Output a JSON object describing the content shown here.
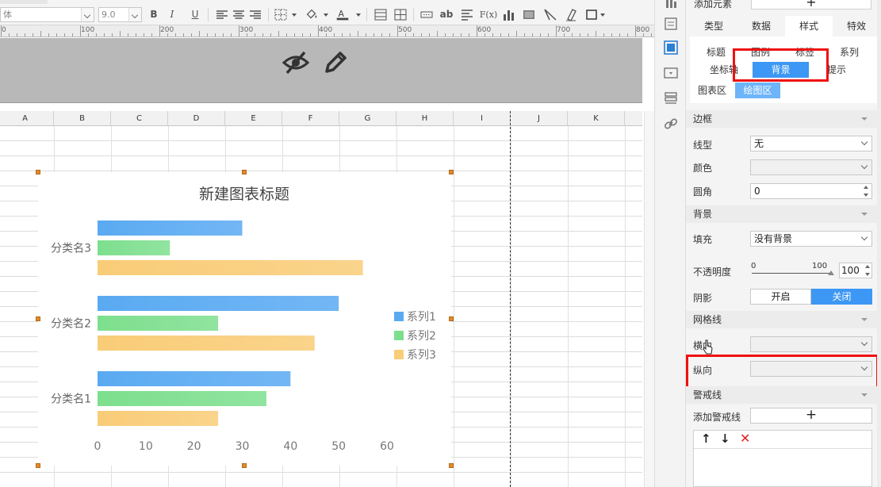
{
  "toolbar": {
    "font_name_value": "体",
    "font_size_value": "9.0",
    "bold_label": "B",
    "italic_label": "I",
    "underline_label": "U",
    "wrap_label": "ab",
    "formula_label": "F(x)"
  },
  "ruler": {
    "labels": [
      "0",
      "100",
      "200",
      "300",
      "400",
      "500",
      "600",
      "700",
      "800"
    ]
  },
  "sheet": {
    "columns": [
      "A",
      "B",
      "C",
      "D",
      "E",
      "F",
      "G",
      "H",
      "I",
      "J",
      "K"
    ]
  },
  "chart": {
    "colors": {
      "series1": "#5aaaf2",
      "series2": "#7ddf8e",
      "series3": "#f9cc77"
    }
  },
  "chart_data": {
    "type": "bar",
    "orientation": "horizontal",
    "title": "新建图表标题",
    "categories": [
      "分类名1",
      "分类名2",
      "分类名3"
    ],
    "series": [
      {
        "name": "系列1",
        "values": [
          40,
          50,
          30
        ]
      },
      {
        "name": "系列2",
        "values": [
          35,
          25,
          15
        ]
      },
      {
        "name": "系列3",
        "values": [
          25,
          45,
          55
        ]
      }
    ],
    "xlim": [
      0,
      60
    ],
    "x_ticks": [
      "0",
      "10",
      "20",
      "30",
      "40",
      "50",
      "60"
    ],
    "grid": false,
    "legend_position": "right"
  },
  "panel": {
    "add_element_label": "添加元素",
    "add_element_symbol": "+",
    "main_tabs": [
      "类型",
      "数据",
      "样式",
      "特效"
    ],
    "sub_tabs_row1": [
      "标题",
      "图例",
      "标签",
      "系列"
    ],
    "sub_tabs_row2": [
      "坐标轴",
      "背景",
      "提示"
    ],
    "area_tabs": [
      "图表区",
      "绘图区"
    ],
    "border_section": "边框",
    "line_type_label": "线型",
    "line_type_value": "无",
    "color_label": "颜色",
    "radius_label": "圆角",
    "radius_value": "0",
    "background_section": "背景",
    "fill_label": "填充",
    "fill_value": "没有背景",
    "opacity_label": "不透明度",
    "opacity_min": "0",
    "opacity_max": "100",
    "opacity_value": "100",
    "shadow_label": "阴影",
    "shadow_on": "开启",
    "shadow_off": "关闭",
    "gridline_section": "网格线",
    "horizontal_label": "横向",
    "vertical_label": "纵向",
    "warning_section": "警戒线",
    "add_warning_label": "添加警戒线",
    "add_warning_symbol": "+",
    "up_symbol": "↑",
    "down_symbol": "↓",
    "delete_symbol": "✕"
  }
}
